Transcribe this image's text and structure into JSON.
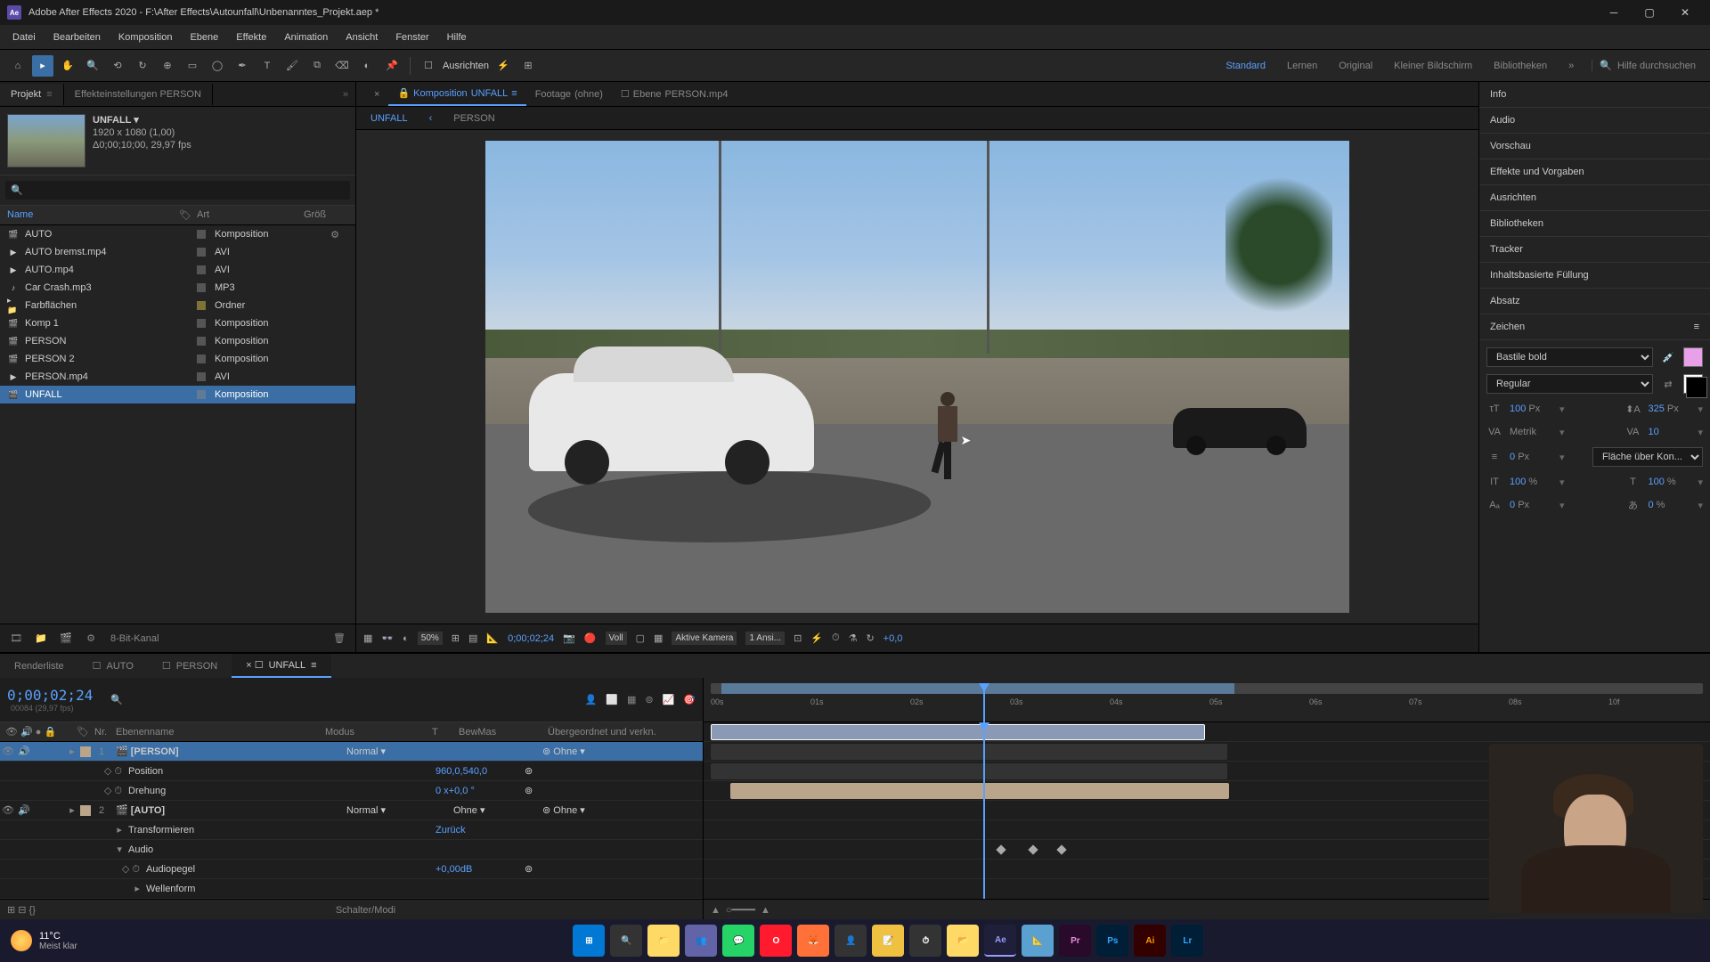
{
  "title": "Adobe After Effects 2020 - F:\\After Effects\\Autounfall\\Unbenanntes_Projekt.aep *",
  "menu": [
    "Datei",
    "Bearbeiten",
    "Komposition",
    "Ebene",
    "Effekte",
    "Animation",
    "Ansicht",
    "Fenster",
    "Hilfe"
  ],
  "toolbar": {
    "ausrichten": "Ausrichten",
    "search": "Hilfe durchsuchen"
  },
  "workspaces": [
    "Standard",
    "Lernen",
    "Original",
    "Kleiner Bildschirm",
    "Bibliotheken"
  ],
  "project": {
    "tab": "Projekt",
    "effects_tab": "Effekteinstellungen PERSON",
    "name": "UNFALL",
    "dims": "1920 x 1080 (1,00)",
    "dur": "Δ0;00;10;00, 29,97 fps",
    "cols": {
      "name": "Name",
      "type": "Art",
      "size": "Größ"
    },
    "items": [
      {
        "name": "AUTO",
        "type": "Komposition",
        "icon": "comp",
        "extra": "⚙"
      },
      {
        "name": "AUTO bremst.mp4",
        "type": "AVI",
        "icon": "vid"
      },
      {
        "name": "AUTO.mp4",
        "type": "AVI",
        "icon": "vid"
      },
      {
        "name": "Car Crash.mp3",
        "type": "MP3",
        "icon": "aud"
      },
      {
        "name": "Farbflächen",
        "type": "Ordner",
        "icon": "fold",
        "color": "#d9c24a"
      },
      {
        "name": "Komp 1",
        "type": "Komposition",
        "icon": "comp"
      },
      {
        "name": "PERSON",
        "type": "Komposition",
        "icon": "comp"
      },
      {
        "name": "PERSON 2",
        "type": "Komposition",
        "icon": "comp"
      },
      {
        "name": "PERSON.mp4",
        "type": "AVI",
        "icon": "vid"
      },
      {
        "name": "UNFALL",
        "type": "Komposition",
        "icon": "comp",
        "selected": true
      }
    ],
    "bitdepth": "8-Bit-Kanal"
  },
  "comp": {
    "tabs": [
      {
        "pre": "Komposition",
        "name": "UNFALL",
        "active": true
      },
      {
        "pre": "Footage",
        "name": "(ohne)"
      },
      {
        "pre": "Ebene",
        "name": "PERSON.mp4"
      }
    ],
    "subtabs": [
      "UNFALL",
      "PERSON"
    ]
  },
  "viewer": {
    "zoom": "50%",
    "time": "0;00;02;24",
    "res": "Voll",
    "cam": "Aktive Kamera",
    "views": "1 Ansi...",
    "exp": "+0,0"
  },
  "right": {
    "sections": [
      "Info",
      "Audio",
      "Vorschau",
      "Effekte und Vorgaben",
      "Ausrichten",
      "Bibliotheken",
      "Tracker",
      "Inhaltsbasierte Füllung",
      "Absatz",
      "Zeichen"
    ],
    "char": {
      "font": "Bastile bold",
      "style": "Regular",
      "size": "100",
      "leading": "325",
      "unit": "Px",
      "kern": "Metrik",
      "track": "10",
      "baseline": "0",
      "fill": "Fläche über Kon...",
      "scaleh": "100",
      "scalev": "100",
      "shift": "0",
      "faux": "0",
      "pct": "%"
    }
  },
  "timeline": {
    "tabs": [
      {
        "name": "Renderliste"
      },
      {
        "name": "AUTO"
      },
      {
        "name": "PERSON"
      },
      {
        "name": "UNFALL",
        "active": true
      }
    ],
    "time": "0;00;02;24",
    "frame": "00084 (29,97 fps)",
    "cols": {
      "num": "Nr.",
      "name": "Ebenenname",
      "mode": "Modus",
      "t": "T",
      "mask": "BewMas",
      "parent": "Übergeordnet und verkn."
    },
    "layers": [
      {
        "num": "1",
        "name": "[PERSON]",
        "mode": "Normal",
        "parent": "Ohne",
        "selected": true
      },
      {
        "prop": true,
        "indent": 1,
        "name": "Position",
        "val": "960,0,540,0",
        "kf": true
      },
      {
        "prop": true,
        "indent": 1,
        "name": "Drehung",
        "val": "0 x+0,0 °",
        "kf": true
      },
      {
        "num": "2",
        "name": "[AUTO]",
        "mode": "Normal",
        "trk": "Ohne",
        "parent": "Ohne"
      },
      {
        "prop": true,
        "indent": 1,
        "name": "Transformieren",
        "val": "Zurück"
      },
      {
        "prop": true,
        "indent": 1,
        "name": "Audio",
        "expand": true
      },
      {
        "prop": true,
        "indent": 2,
        "name": "Audiopegel",
        "val": "+0,00dB",
        "kf": true
      },
      {
        "prop": true,
        "indent": 2,
        "name": "Wellenform"
      }
    ],
    "footer": "Schalter/Modi",
    "ruler": [
      "00s",
      "01s",
      "02s",
      "03s",
      "04s",
      "05s",
      "06s",
      "07s",
      "08s",
      "10f"
    ]
  },
  "taskbar": {
    "temp": "11°C",
    "cond": "Meist klar"
  }
}
